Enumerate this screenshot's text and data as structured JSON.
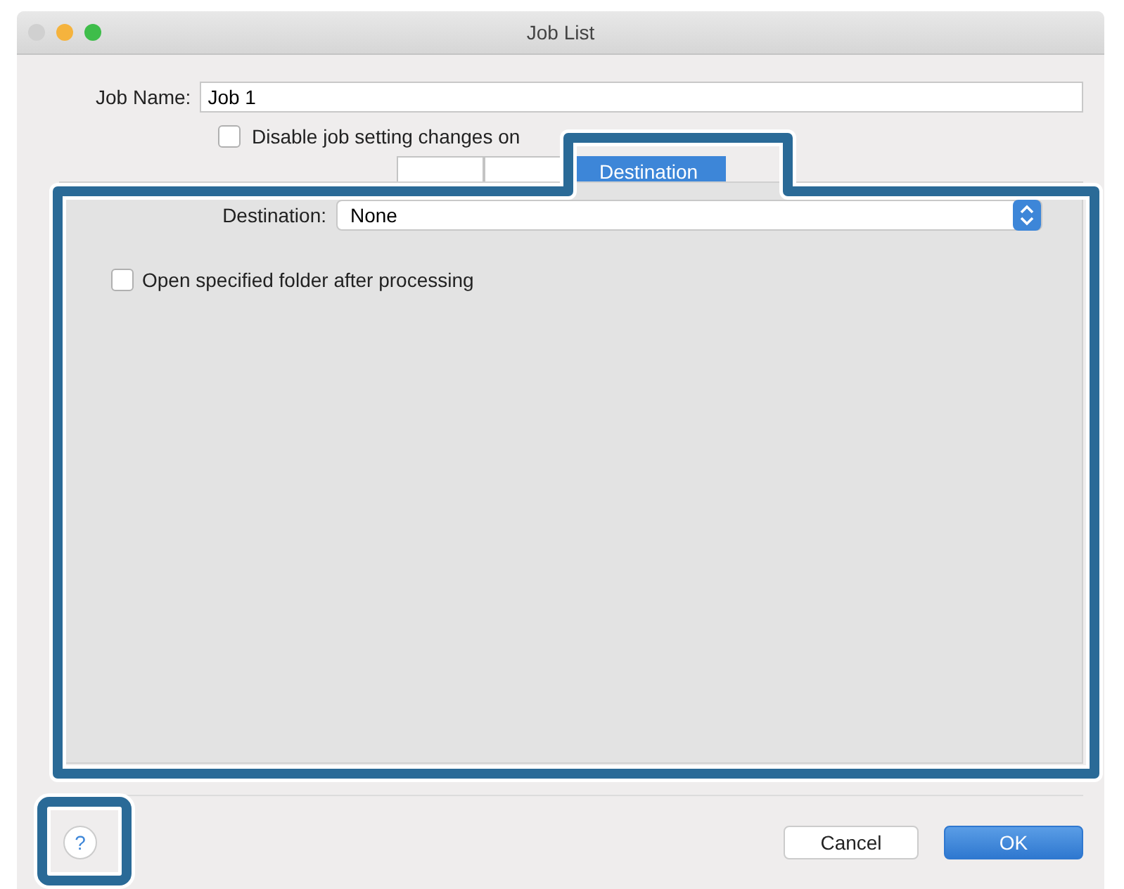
{
  "window": {
    "title": "Job List"
  },
  "job_name": {
    "label": "Job Name:",
    "value": "Job 1"
  },
  "disable_option": {
    "label": "Disable job setting changes on",
    "checked": false
  },
  "tabs": [
    {
      "selected": false
    },
    {
      "selected": false
    },
    {
      "label": "Destination",
      "selected": true
    }
  ],
  "destination": {
    "label": "Destination:",
    "value": "None"
  },
  "open_folder": {
    "label": "Open specified folder after processing",
    "checked": false
  },
  "help_button": {
    "label": "?"
  },
  "buttons": [
    {
      "label": "Cancel",
      "kind": "normal"
    },
    {
      "label": "OK",
      "kind": "default"
    }
  ]
}
